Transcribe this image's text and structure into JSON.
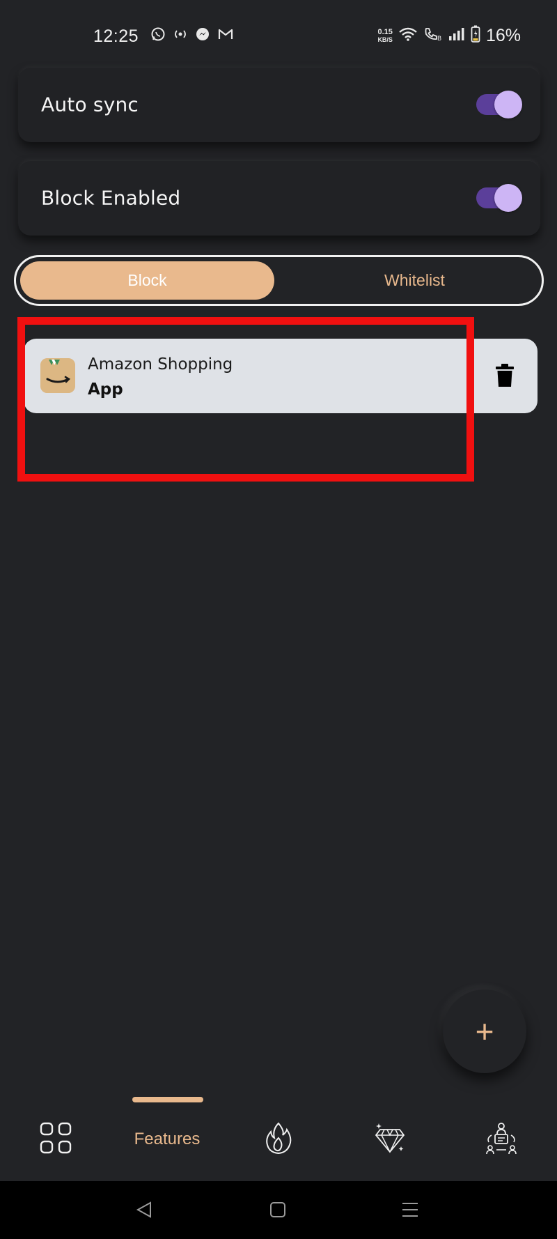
{
  "status_bar": {
    "time": "12:25",
    "net_speed_value": "0.15",
    "net_speed_unit": "KB/S",
    "battery": "16%"
  },
  "settings": {
    "auto_sync": {
      "label": "Auto sync",
      "enabled": true
    },
    "block_enabled": {
      "label": "Block Enabled",
      "enabled": true
    }
  },
  "tabs": {
    "block": "Block",
    "whitelist": "Whitelist",
    "selected": "Block"
  },
  "blocked_items": [
    {
      "name": "Amazon Shopping",
      "type": "App",
      "icon": "amazon-shopping-icon"
    }
  ],
  "fab": {
    "label": "+"
  },
  "bottom_nav": {
    "features": "Features",
    "active": "Features"
  },
  "colors": {
    "accent": "#e9b98d",
    "toggle_track": "#5b3f9a",
    "toggle_knob": "#cdb5f5",
    "highlight": "#f01010",
    "background": "#222326"
  }
}
